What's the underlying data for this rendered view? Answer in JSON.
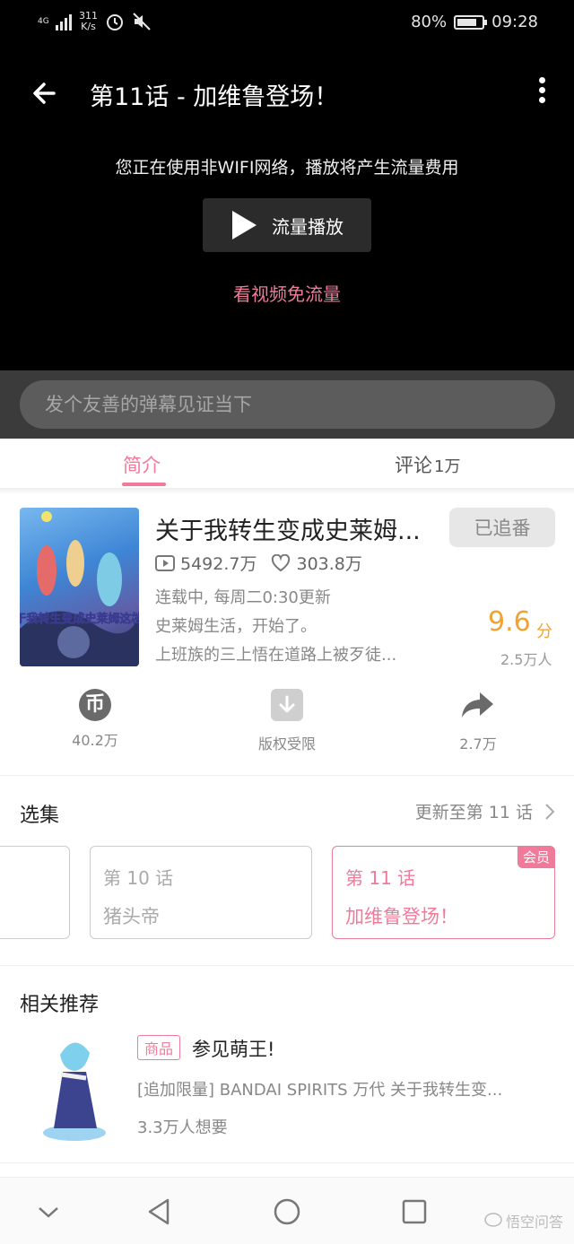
{
  "status_bar": {
    "signal_label": "4G",
    "speed_value": "311",
    "speed_unit": "K/s",
    "battery": "80%",
    "time": "09:28"
  },
  "player": {
    "title": "第11话 - 加维鲁登场！",
    "network_notice": "您正在使用非WIFI网络，播放将产生流量费用",
    "play_button_label": "流量播放",
    "free_data_link": "看视频免流量",
    "danmaku_placeholder": "发个友善的弹幕见证当下"
  },
  "tabs": [
    {
      "label": "简介",
      "active": true
    },
    {
      "label": "评论",
      "count": "1万",
      "active": false
    }
  ],
  "anime": {
    "title": "关于我转生变成史莱姆...",
    "follow_label": "已追番",
    "plays": "5492.7万",
    "likes": "303.8万",
    "status": "连载中, 每周二0:30更新",
    "desc_line1": "史莱姆生活，开始了。",
    "desc_line2": "上班族的三上悟在道路上被歹徒...",
    "score": "9.6",
    "score_unit": "分",
    "raters": "2.5万人",
    "cover_text": "关于我转生变成史莱姆这档事"
  },
  "actions": [
    {
      "icon": "coin-icon",
      "label": "40.2万"
    },
    {
      "icon": "download-icon",
      "label": "版权受限"
    },
    {
      "icon": "share-icon",
      "label": "2.7万"
    }
  ],
  "episodes": {
    "section_title": "选集",
    "update_text": "更新至第 11 话",
    "items": [
      {
        "num": "第 10 话",
        "name": "猪头帝"
      },
      {
        "num": "第 11 话",
        "name": "加维鲁登场！",
        "badge": "会员"
      }
    ]
  },
  "recommendations": {
    "section_title": "相关推荐",
    "item": {
      "tag": "商品",
      "title": "参见萌王!",
      "desc": "[追加限量] BANDAI SPIRITS 万代 关于我转生变...",
      "want": "3.3万人想要"
    }
  },
  "watermark": "悟空问答",
  "colors": {
    "accent": "#f07a9a",
    "score": "#f2a331"
  }
}
